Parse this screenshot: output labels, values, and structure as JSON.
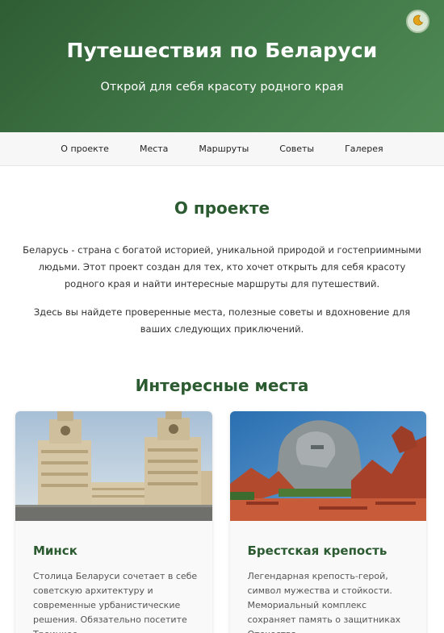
{
  "hero": {
    "title": "Путешествия по Беларуси",
    "subtitle": "Открой для себя красоту родного края",
    "theme_toggle_icon": "moon-icon"
  },
  "nav": {
    "items": [
      "О проекте",
      "Места",
      "Маршруты",
      "Советы",
      "Галерея"
    ]
  },
  "about": {
    "title": "О проекте",
    "paragraph1": "Беларусь - страна с богатой историей, уникальной природой и гостеприимными людьми. Этот проект создан для тех, кто хочет открыть для себя красоту родного края и найти интересные маршруты для путешествий.",
    "paragraph2": "Здесь вы найдете проверенные места, полезные советы и вдохновение для ваших следующих приключений."
  },
  "places": {
    "title": "Интересные места",
    "cards": [
      {
        "title": "Минск",
        "description": "Столица Беларуси сочетает в себе советскую архитектуру и современные урбанистические решения. Обязательно посетите Троицкое"
      },
      {
        "title": "Брестская крепость",
        "description": "Легендарная крепость-герой, символ мужества и стойкости. Мемориальный комплекс сохраняет память о защитниках Отечества."
      }
    ]
  },
  "colors": {
    "hero_green": "#3e7445",
    "heading_green": "#2c5a31"
  }
}
